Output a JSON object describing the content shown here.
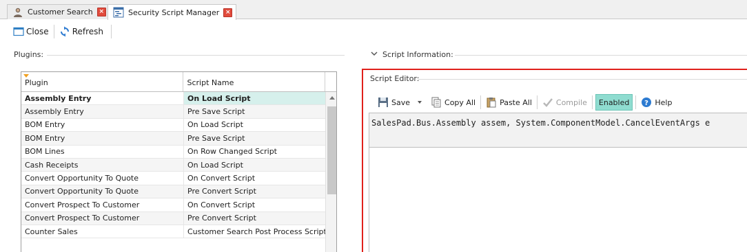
{
  "tabs": [
    {
      "label": "Customer Search",
      "icon": "user-icon",
      "active": false
    },
    {
      "label": "Security Script Manager",
      "icon": "script-icon",
      "active": true
    }
  ],
  "toolbar": {
    "close_label": "Close",
    "refresh_label": "Refresh"
  },
  "plugins": {
    "group_label": "Plugins:",
    "columns": [
      "Plugin",
      "Script Name"
    ],
    "rows": [
      {
        "plugin": "Assembly Entry",
        "script": "On Load Script",
        "selected": true
      },
      {
        "plugin": "Assembly Entry",
        "script": "Pre Save Script"
      },
      {
        "plugin": "BOM Entry",
        "script": "On Load Script"
      },
      {
        "plugin": "BOM Entry",
        "script": "Pre Save Script"
      },
      {
        "plugin": "BOM Lines",
        "script": "On Row Changed Script"
      },
      {
        "plugin": "Cash Receipts",
        "script": "On Load Script"
      },
      {
        "plugin": "Convert Opportunity To Quote",
        "script": "On Convert Script"
      },
      {
        "plugin": "Convert Opportunity To Quote",
        "script": "Pre Convert Script"
      },
      {
        "plugin": "Convert Prospect To Customer",
        "script": "On Convert Script"
      },
      {
        "plugin": "Convert Prospect To Customer",
        "script": "Pre Convert Script"
      },
      {
        "plugin": "Counter Sales",
        "script": "Customer Search Post Process Script"
      }
    ]
  },
  "script_info": {
    "label": "Script Information:"
  },
  "editor": {
    "label": "Script Editor:",
    "save_label": "Save",
    "copy_all_label": "Copy All",
    "paste_all_label": "Paste All",
    "compile_label": "Compile",
    "enabled_label": "Enabled",
    "help_label": "Help",
    "signature": "SalesPad.Bus.Assembly assem, System.ComponentModel.CancelEventArgs e"
  },
  "colors": {
    "highlight_border": "#e0201b",
    "selected_cell": "#d6f0ec",
    "enabled_bg": "#8fdcd0",
    "close_tab": "#e14b3c"
  }
}
